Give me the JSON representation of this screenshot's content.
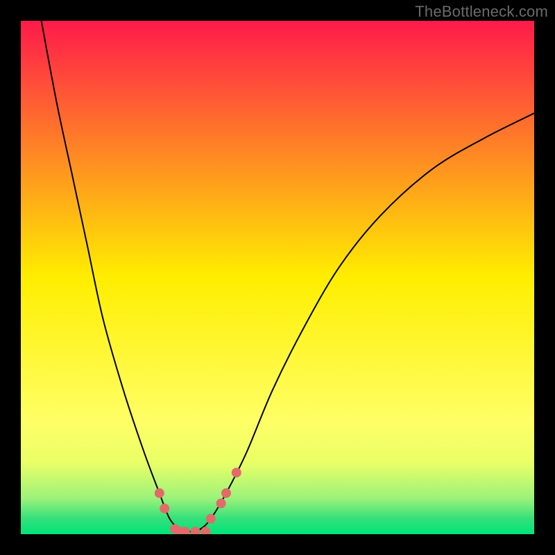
{
  "watermark": "TheBottleneck.com",
  "chart_data": {
    "type": "line",
    "title": "",
    "xlabel": "",
    "ylabel": "",
    "xlim": [
      0,
      100
    ],
    "ylim": [
      0,
      100
    ],
    "grid": false,
    "legend": false,
    "background_gradient": {
      "stops": [
        {
          "pos": 0.0,
          "color": "#ff1a4b"
        },
        {
          "pos": 0.5,
          "color": "#ffee00"
        },
        {
          "pos": 0.78,
          "color": "#ffff66"
        },
        {
          "pos": 0.86,
          "color": "#eaff66"
        },
        {
          "pos": 0.93,
          "color": "#9cf27a"
        },
        {
          "pos": 0.97,
          "color": "#33e07a"
        },
        {
          "pos": 1.0,
          "color": "#00e47a"
        }
      ]
    },
    "series": [
      {
        "name": "bottleneck-curve",
        "color": "#000000",
        "x": [
          4,
          7,
          10,
          13,
          16,
          20,
          24,
          27,
          29,
          31,
          33,
          35,
          37,
          40,
          44,
          49,
          55,
          62,
          70,
          80,
          90,
          100
        ],
        "y": [
          100,
          84,
          70,
          56,
          42,
          28,
          16,
          8,
          3,
          1,
          0.5,
          1,
          3,
          8,
          16,
          28,
          40,
          52,
          62,
          71,
          77,
          82
        ]
      }
    ],
    "markers": {
      "name": "highlight-points",
      "color": "#e26a6a",
      "radius_px": 7,
      "points": [
        {
          "x": 27,
          "y": 8
        },
        {
          "x": 28,
          "y": 5
        },
        {
          "x": 30,
          "y": 1
        },
        {
          "x": 31,
          "y": 0.5
        },
        {
          "x": 32,
          "y": 0.5
        },
        {
          "x": 34,
          "y": 0.5
        },
        {
          "x": 36,
          "y": 0.5
        },
        {
          "x": 37,
          "y": 3
        },
        {
          "x": 39,
          "y": 6
        },
        {
          "x": 40,
          "y": 8
        },
        {
          "x": 42,
          "y": 12
        }
      ]
    }
  }
}
